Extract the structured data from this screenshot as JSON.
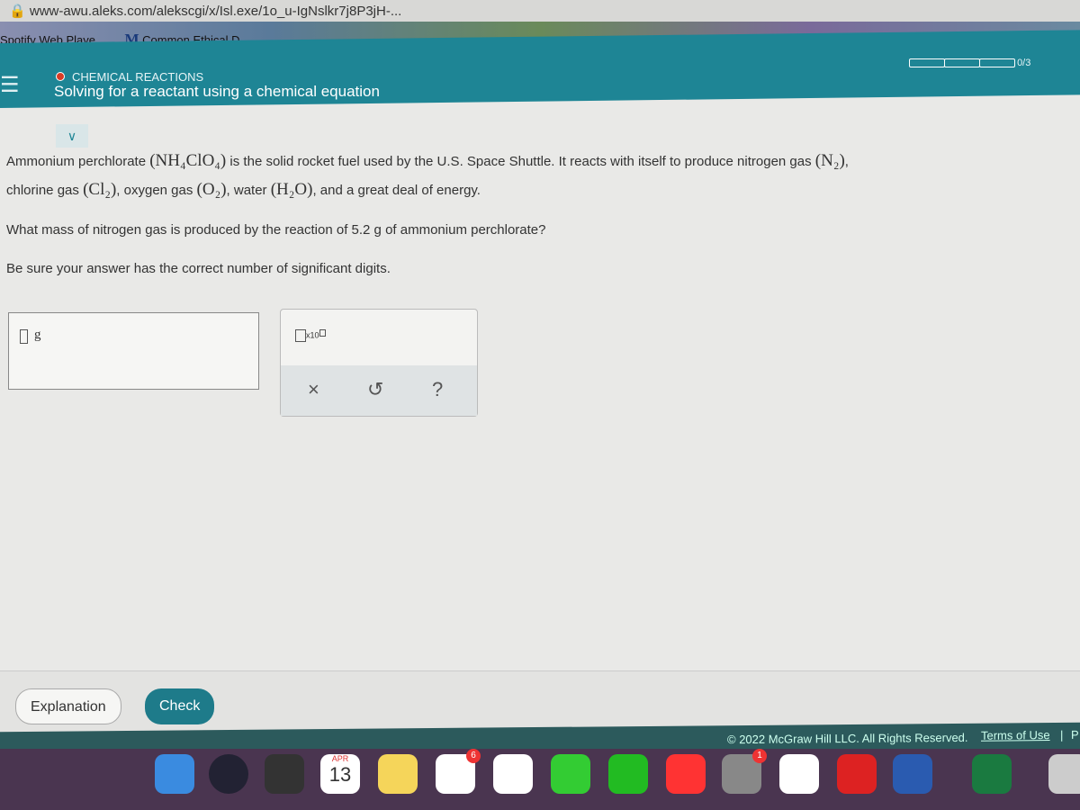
{
  "browser": {
    "url": "www-awu.aleks.com/alekscgi/x/Isl.exe/1o_u-IgNslkr7j8P3jH-...",
    "bookmarks": [
      "Spotify Web Playe...",
      "Common Ethical D..."
    ],
    "bookmark_icon": "M"
  },
  "header": {
    "topic": "CHEMICAL REACTIONS",
    "title": "Solving for a reactant using a chemical equation",
    "progress": "0/3",
    "progress_value": 0,
    "accent": "#1e8595"
  },
  "problem": {
    "line1a": "Ammonium perchlorate ",
    "f1": "(NH₄ClO₄)",
    "line1b": " is the solid rocket fuel used by the U.S. Space Shuttle. It reacts with itself to produce nitrogen gas ",
    "f2": "(N₂)",
    ",": ",",
    "line2a": "chlorine gas ",
    "f3": "(Cl₂)",
    "line2b": ", oxygen gas ",
    "f4": "(O₂)",
    "line2c": ", water ",
    "f5": "(H₂O)",
    "line2d": ", and a great deal of energy.",
    "question": "What mass of nitrogen gas is produced by the reaction of 5.2 g of ammonium perchlorate?",
    "note": "Be sure your answer has the correct number of significant digits."
  },
  "answer": {
    "value": "",
    "unit": "g"
  },
  "tools": {
    "sci": "x10",
    "clear": "×",
    "undo": "↺",
    "help": "?"
  },
  "buttons": {
    "explanation": "Explanation",
    "check": "Check"
  },
  "footer": {
    "copyright": "© 2022 McGraw Hill LLC. All Rights Reserved.",
    "terms": "Terms of Use",
    "sep": "|",
    "privacy": "P"
  },
  "dock": {
    "calendar_month": "APR",
    "calendar_day": "13",
    "mail_badge": "6",
    "settings_badge": "1"
  }
}
